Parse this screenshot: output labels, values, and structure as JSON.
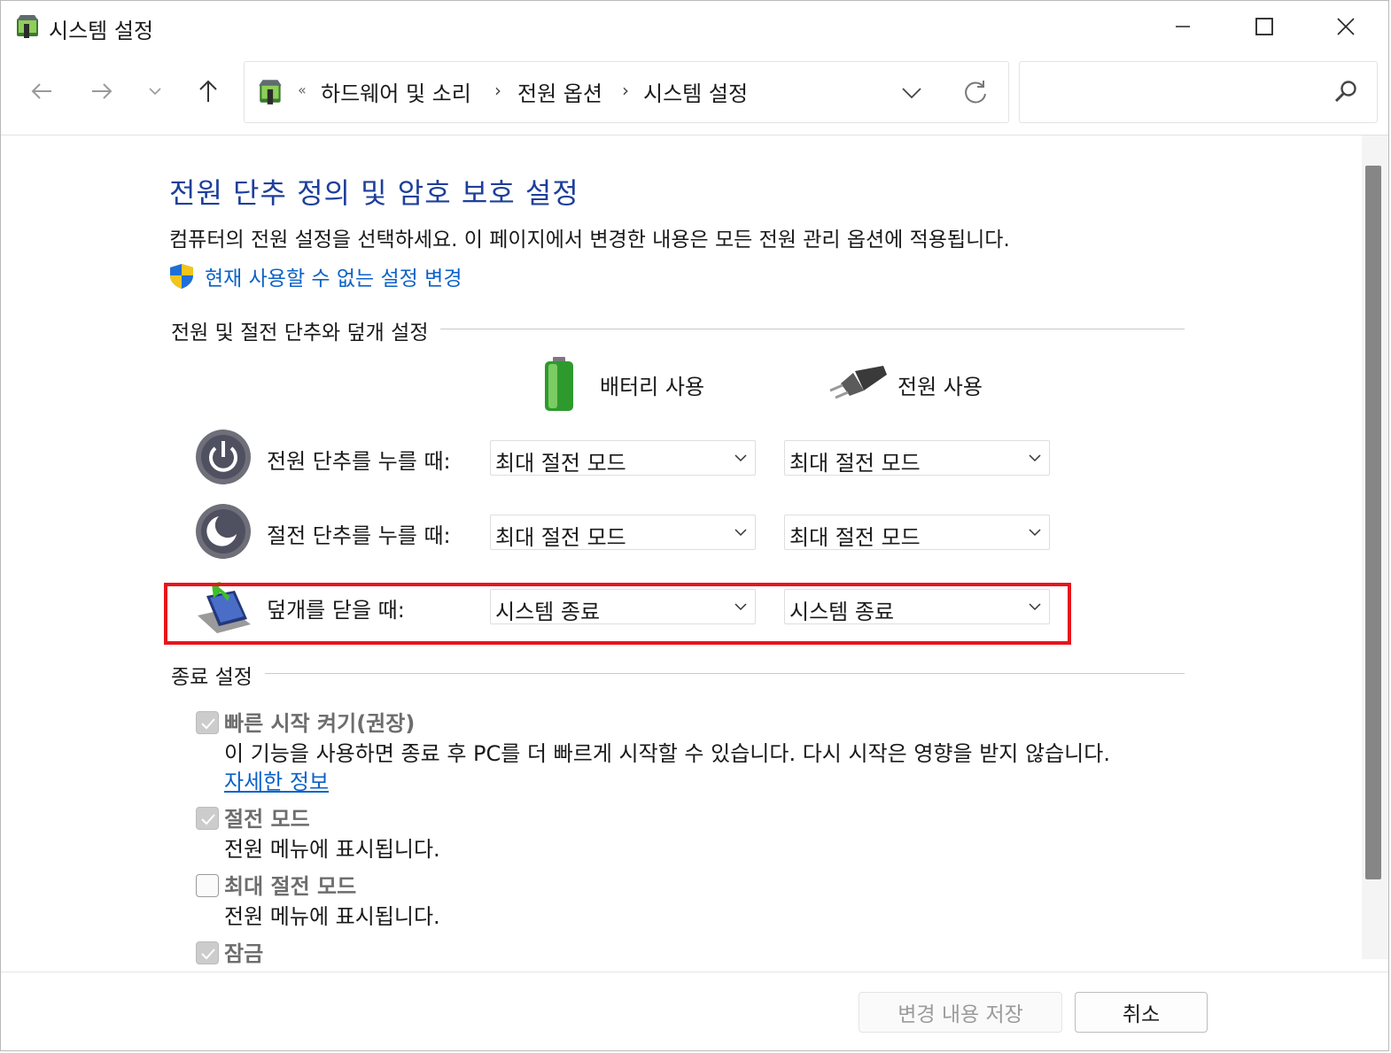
{
  "window": {
    "title": "시스템 설정"
  },
  "address_bar": {
    "overflow": "«",
    "crumbs": [
      "하드웨어 및 소리",
      "전원 옵션",
      "시스템 설정"
    ],
    "separator": "›"
  },
  "search": {
    "placeholder": "",
    "value": ""
  },
  "header": {
    "title": "전원 단추 정의 및 암호 보호 설정",
    "description": "컴퓨터의 전원 설정을 선택하세요. 이 페이지에서 변경한 내용은 모든 전원 관리 옵션에 적용됩니다.",
    "change_link": "현재 사용할 수 없는 설정 변경"
  },
  "buttons_section": {
    "heading": "전원 및 절전 단추와 덮개 설정",
    "columns": {
      "battery": "배터리 사용",
      "plugged": "전원 사용"
    },
    "rows": [
      {
        "label": "전원 단추를 누를 때:",
        "battery": "최대 절전 모드",
        "plugged": "최대 절전 모드"
      },
      {
        "label": "절전 단추를 누를 때:",
        "battery": "최대 절전 모드",
        "plugged": "최대 절전 모드"
      },
      {
        "label": "덮개를 닫을 때:",
        "battery": "시스템 종료",
        "plugged": "시스템 종료"
      }
    ]
  },
  "shutdown_section": {
    "heading": "종료 설정",
    "options": [
      {
        "title": "빠른 시작 켜기(권장)",
        "desc": "이 기능을 사용하면 종료 후 PC를 더 빠르게 시작할 수 있습니다. 다시 시작은 영향을 받지 않습니다.",
        "checked": true
      },
      {
        "title": "절전 모드",
        "desc": "전원 메뉴에 표시됩니다.",
        "checked": true
      },
      {
        "title": "최대 절전 모드",
        "desc": "전원 메뉴에 표시됩니다.",
        "checked": false
      },
      {
        "title": "잠금",
        "desc": "",
        "checked": true
      }
    ],
    "more_link": "자세한 정보"
  },
  "footer": {
    "save_label": "변경 내용 저장",
    "cancel_label": "취소"
  },
  "colors": {
    "title_blue": "#1e3f9a",
    "link_blue": "#0b62c8",
    "highlight_red": "#e8141c"
  }
}
